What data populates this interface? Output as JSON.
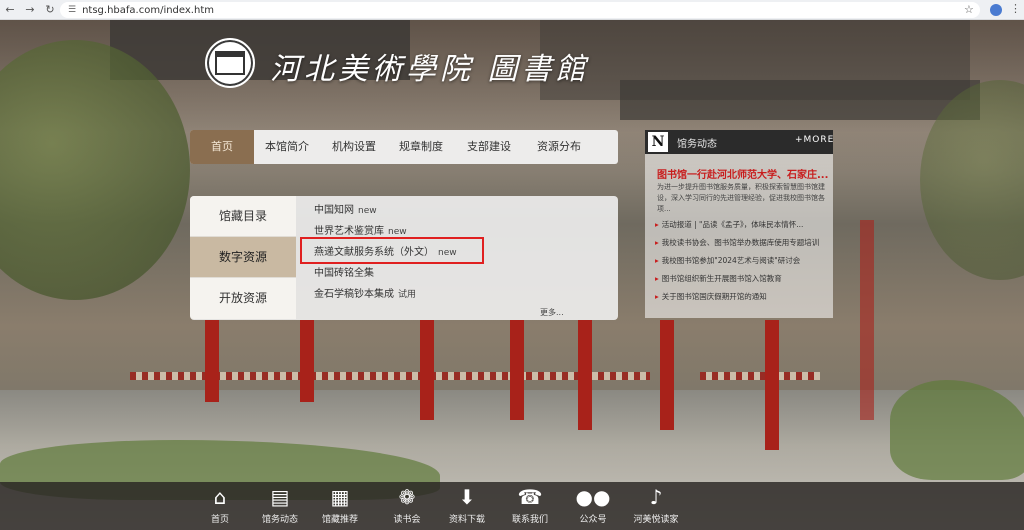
{
  "browser": {
    "url": "ntsg.hbafa.com/index.htm",
    "back_icon": "back-arrow-icon",
    "forward_icon": "forward-arrow-icon",
    "reload_icon": "reload-icon"
  },
  "site": {
    "title": "河北美術學院  圖書館"
  },
  "mainnav": {
    "items": [
      {
        "label": "首页"
      },
      {
        "label": "本馆简介"
      },
      {
        "label": "机构设置"
      },
      {
        "label": "规章制度"
      },
      {
        "label": "支部建设"
      },
      {
        "label": "资源分布"
      }
    ]
  },
  "resources": {
    "tabs": [
      {
        "label": "馆藏目录"
      },
      {
        "label": "数字资源"
      },
      {
        "label": "开放资源"
      }
    ],
    "items": [
      {
        "label": "中国知网",
        "tag": "new"
      },
      {
        "label": "世界艺术鉴赏库",
        "tag": "new"
      },
      {
        "label": "燕递文献服务系统（外文）",
        "tag": "new"
      },
      {
        "label": "中国砖铭全集",
        "tag": ""
      },
      {
        "label": "金石学稿钞本集成",
        "tag": "试用"
      }
    ],
    "more": "更多..."
  },
  "news": {
    "badge": "N",
    "title": "馆务动态",
    "more": "+MORE",
    "feature": "图书馆一行赴河北师范大学、石家庄...",
    "feature_desc": "为进一步提升图书馆服务质量，积极探索智慧图书馆建设，深入学习同行的先进管理经验，促进我校图书馆各项...",
    "items": [
      "活动报道 | \"品读《孟子》，体味民本情怀...",
      "我校读书协会、图书馆举办数据库使用专题培训",
      "我校图书馆参加\"2024艺术与阅读\"研讨会",
      "图书馆组织新生开展图书馆入馆教育",
      "关于图书馆国庆假期开馆的通知"
    ]
  },
  "bottombar": {
    "items": [
      {
        "label": "首页",
        "icon": "home-icon"
      },
      {
        "label": "馆务动态",
        "icon": "news-icon"
      },
      {
        "label": "馆藏推荐",
        "icon": "bookshelf-icon"
      },
      {
        "label": "读书会",
        "icon": "reading-club-icon"
      },
      {
        "label": "资料下载",
        "icon": "download-icon"
      },
      {
        "label": "联系我们",
        "icon": "phone-icon"
      },
      {
        "label": "公众号",
        "icon": "wechat-icon"
      },
      {
        "label": "河美悦读家",
        "icon": "douyin-icon"
      }
    ]
  }
}
